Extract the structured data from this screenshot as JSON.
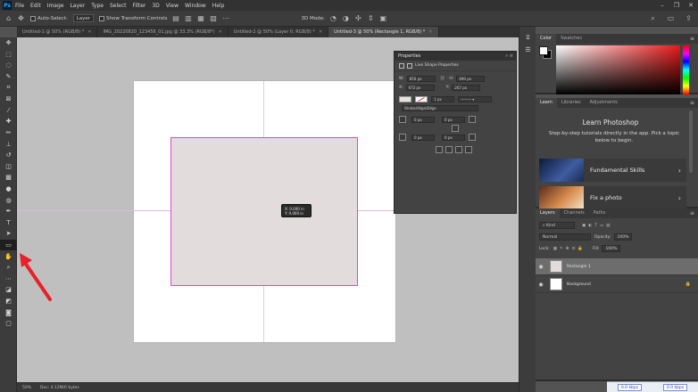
{
  "app": {
    "menu": [
      "File",
      "Edit",
      "Image",
      "Layer",
      "Type",
      "Select",
      "Filter",
      "3D",
      "View",
      "Window",
      "Help"
    ],
    "logo": "Ps",
    "window_controls": [
      "–",
      "❐",
      "✕"
    ]
  },
  "options_bar": {
    "auto_select_label": "Auto-Select:",
    "auto_select_value": "Layer",
    "show_transform_label": "Show Transform Controls",
    "mode_label": "3D Mode:"
  },
  "tabs": [
    {
      "label": "Untitled-1 @ 50% (RGB/8) *"
    },
    {
      "label": "IMG_20220820_123456_01.jpg @ 33.3% (RGB/8*)"
    },
    {
      "label": "Untitled-2 @ 50% (Layer 0, RGB/8) *"
    },
    {
      "label": "Untitled-3 @ 50% (Rectangle 1, RGB/8) *",
      "active": true
    }
  ],
  "tooltip": {
    "line1": "X: 0.000 in",
    "line2": "Y: 0.000 in"
  },
  "status": {
    "zoom": "50%",
    "doc": "Doc: 4.12M/0 bytes"
  },
  "properties": {
    "title": "Properties",
    "section": "Live Shape Properties",
    "w_label": "W:",
    "w_value": "850 px",
    "h_label": "H:",
    "h_value": "690 px",
    "x_label": "X:",
    "x_value": "672 px",
    "y_label": "Y:",
    "y_value": "267 px",
    "stroke_width": "1 px",
    "align": "Stroke/Align/Edge",
    "corner_tl": "0 px",
    "corner_tr": "0 px",
    "corner_bl": "0 px",
    "corner_br": "0 px"
  },
  "color_panel": {
    "tabs": [
      "Color",
      "Swatches"
    ],
    "fg": "#ffffff",
    "bg": "#000000",
    "hue": "#e61919"
  },
  "learn_panel": {
    "tabs": [
      "Learn",
      "Libraries",
      "Adjustments"
    ],
    "title": "Learn Photoshop",
    "desc": "Step-by-step tutorials directly in the app. Pick a topic below to begin.",
    "cards": [
      {
        "label": "Fundamental Skills"
      },
      {
        "label": "Fix a photo"
      }
    ]
  },
  "layers_panel": {
    "tabs": [
      "Layers",
      "Channels",
      "Paths"
    ],
    "kind": "Kind",
    "blend": "Normal",
    "opacity_label": "Opacity:",
    "opacity": "100%",
    "lock_label": "Lock:",
    "fill_label": "Fill:",
    "fill": "100%",
    "layers": [
      {
        "name": "Rectangle 1",
        "active": true
      },
      {
        "name": "Background",
        "locked": true
      }
    ]
  },
  "netbar": {
    "up": "0.0 kbps",
    "down": "0.0 kbps"
  },
  "colors": {
    "annotation_arrow": "#e8202a",
    "shape_border": "#d24ec9"
  }
}
